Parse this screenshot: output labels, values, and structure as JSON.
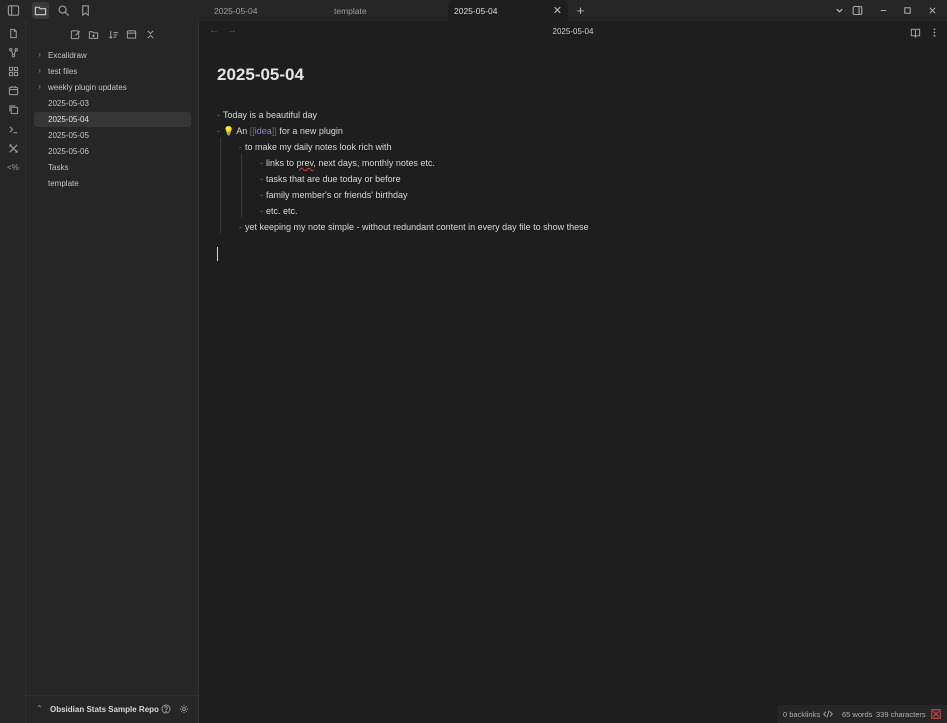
{
  "tabs": [
    {
      "label": "2025-05-04",
      "active": false
    },
    {
      "label": "template",
      "active": false
    },
    {
      "label": "2025-05-04",
      "active": true
    }
  ],
  "sidebar": {
    "items": [
      {
        "label": "Excalidraw",
        "type": "folder",
        "active": false
      },
      {
        "label": "test files",
        "type": "folder",
        "active": false
      },
      {
        "label": "weekly plugin updates",
        "type": "folder",
        "active": false
      },
      {
        "label": "2025-05-03",
        "type": "file",
        "active": false
      },
      {
        "label": "2025-05-04",
        "type": "file",
        "active": true
      },
      {
        "label": "2025-05-05",
        "type": "file",
        "active": false
      },
      {
        "label": "2025-05-06",
        "type": "file",
        "active": false
      },
      {
        "label": "Tasks",
        "type": "file",
        "active": false
      },
      {
        "label": "template",
        "type": "file",
        "active": false
      }
    ],
    "vault_name": "Obsidian Stats Sample Repo"
  },
  "editor": {
    "header_title": "2025-05-04",
    "note_title": "2025-05-04",
    "lines": {
      "l1": "Today is a beautiful day",
      "l2_emoji": "💡",
      "l2_pre": "An",
      "l2_link_open": "[[",
      "l2_link": "idea",
      "l2_link_close": "]]",
      "l2_post": "for a new plugin",
      "l3": "to make my daily notes look rich with",
      "l4_pre": "links to ",
      "l4_misspelled": "prev",
      "l4_post": ", next days, monthly notes etc.",
      "l5": "tasks that are due today or before",
      "l6": "family member's or friends' birthday",
      "l7": "etc. etc.",
      "l8": "yet keeping my note simple - without redundant content in every day file to show these"
    }
  },
  "statusbar": {
    "backlinks": "0 backlinks",
    "words": "65 words",
    "characters": "339 characters"
  },
  "colors": {
    "accent_link": "#8c82d8",
    "sync_error": "#d64545"
  }
}
